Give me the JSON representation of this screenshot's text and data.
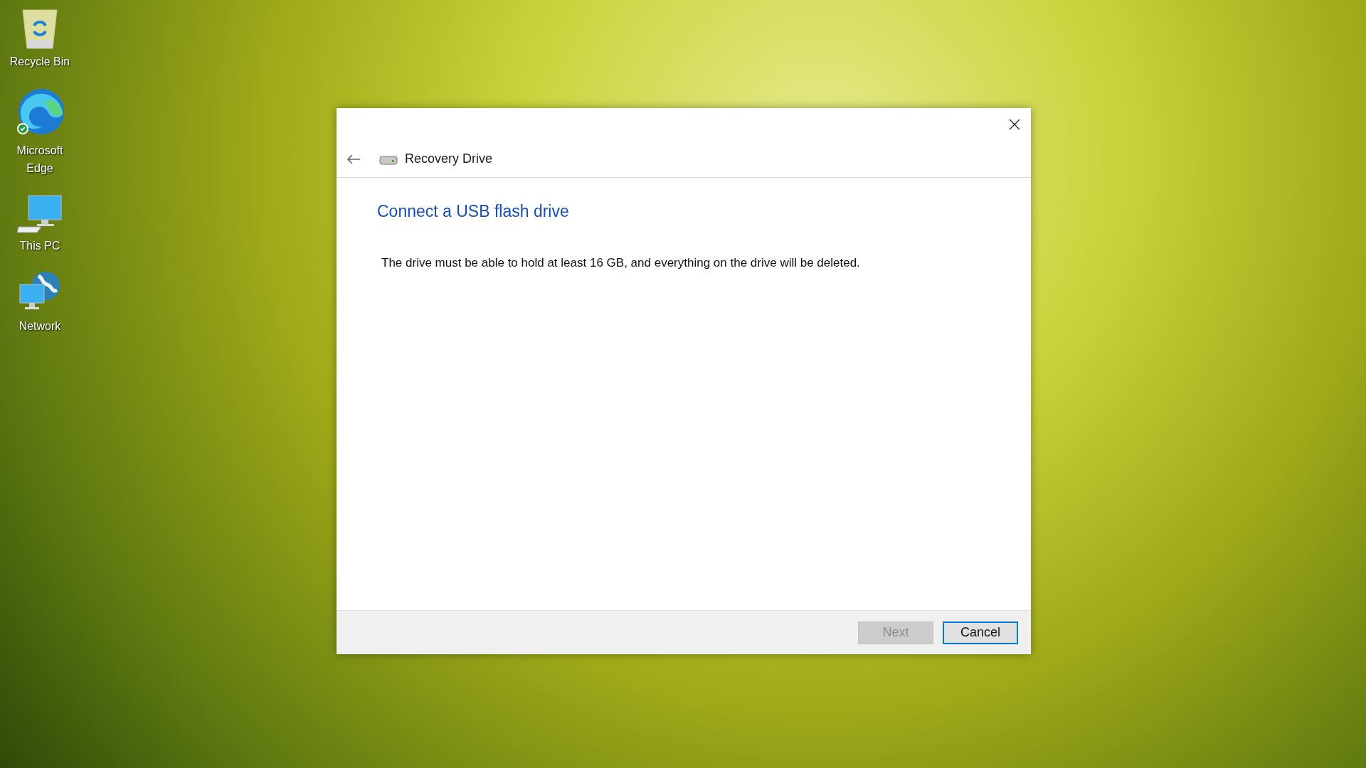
{
  "desktop_icons": [
    {
      "kind": "recycle-bin",
      "label": "Recycle Bin"
    },
    {
      "kind": "edge",
      "label": "Microsoft Edge"
    },
    {
      "kind": "pc",
      "label": "This PC"
    },
    {
      "kind": "network",
      "label": "Network"
    }
  ],
  "dialog": {
    "title": "Recovery Drive",
    "heading": "Connect a USB flash drive",
    "message": "The drive must be able to hold at least 16 GB, and everything on the drive will be deleted.",
    "buttons": [
      {
        "label": "Next",
        "disabled": true,
        "focused": false
      },
      {
        "label": "Cancel",
        "disabled": false,
        "focused": true
      }
    ]
  }
}
